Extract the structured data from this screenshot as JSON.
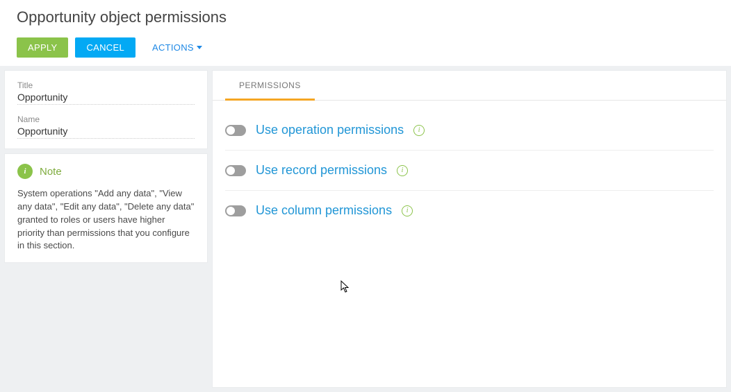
{
  "header": {
    "title": "Opportunity object permissions",
    "apply_label": "APPLY",
    "cancel_label": "CANCEL",
    "actions_label": "ACTIONS"
  },
  "side": {
    "fields": [
      {
        "label": "Title",
        "value": "Opportunity"
      },
      {
        "label": "Name",
        "value": "Opportunity"
      }
    ],
    "note": {
      "heading": "Note",
      "body": "System operations \"Add any data\", \"View any data\", \"Edit any data\", \"Delete any data\" granted to roles or users have higher priority than permissions that you configure in this section."
    }
  },
  "main": {
    "tabs": [
      {
        "label": "PERMISSIONS",
        "active": true
      }
    ],
    "permissions": [
      {
        "label": "Use operation permissions",
        "enabled": false
      },
      {
        "label": "Use record permissions",
        "enabled": false
      },
      {
        "label": "Use column permissions",
        "enabled": false
      }
    ]
  }
}
